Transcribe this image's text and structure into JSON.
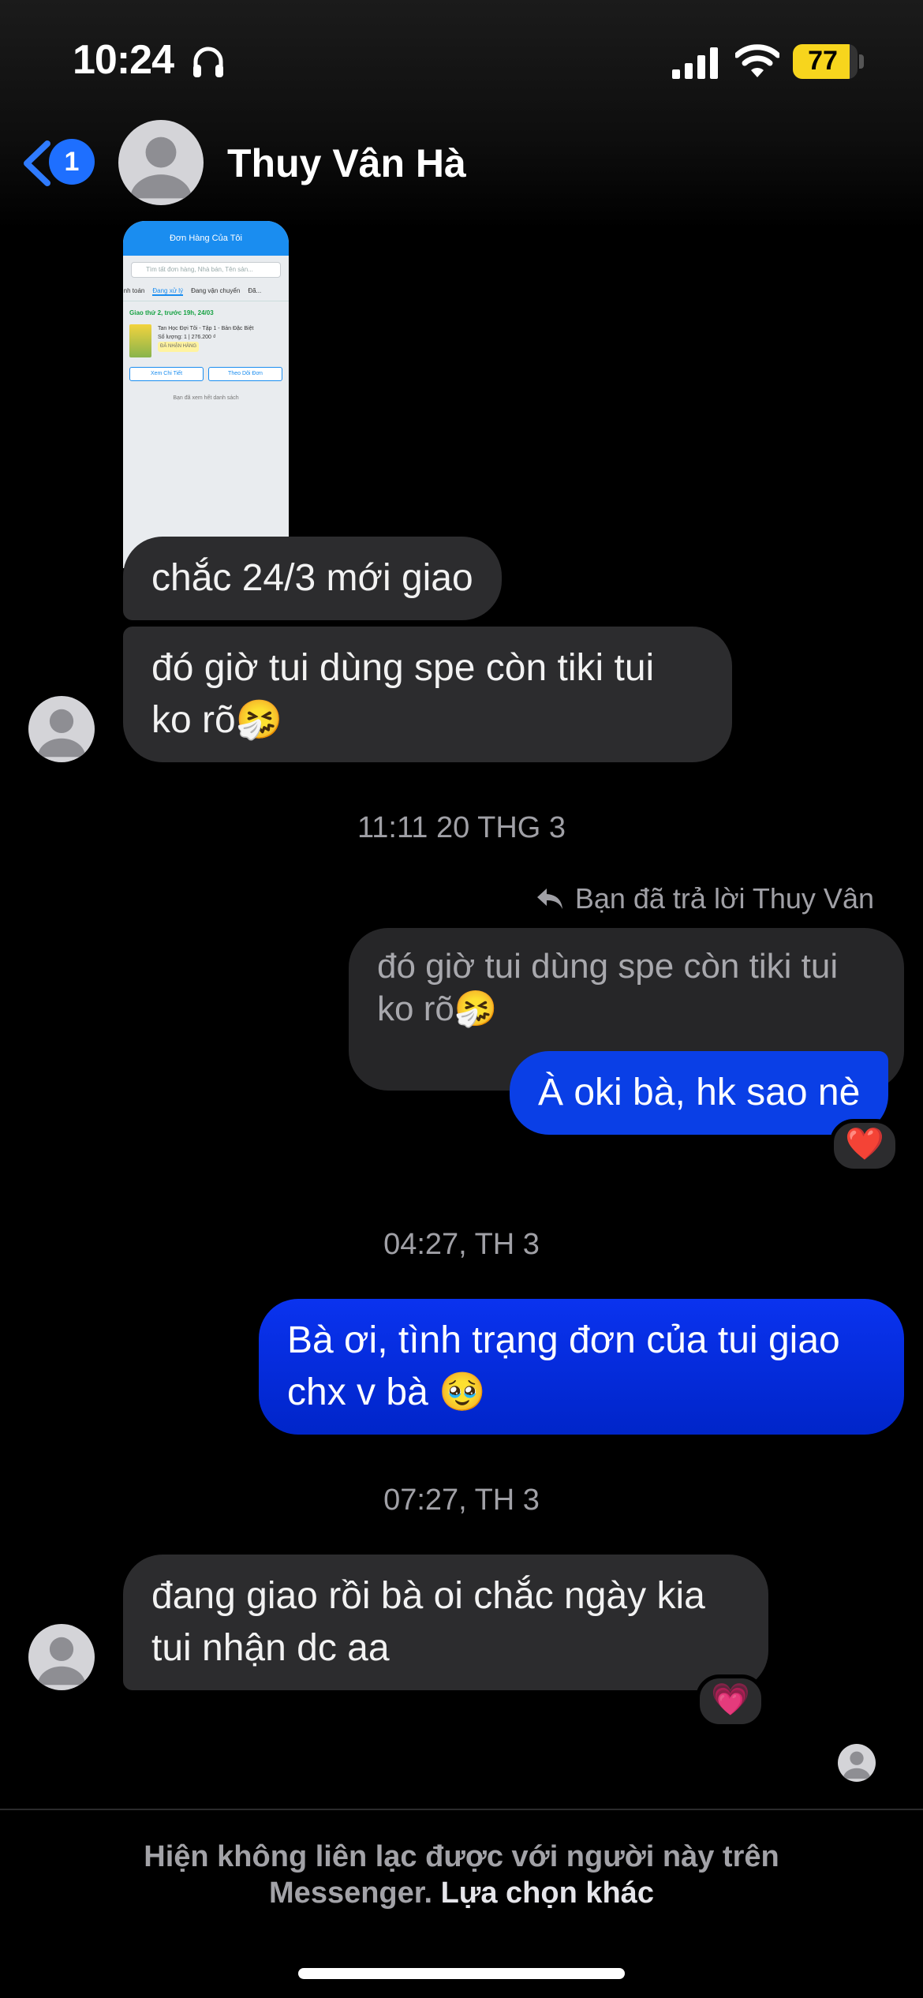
{
  "status_bar": {
    "time": "10:24",
    "battery": "77"
  },
  "header": {
    "back_badge": "1",
    "contact_name": "Thuy Vân Hà"
  },
  "shared_screenshot": {
    "title": "Đơn Hàng Của Tôi",
    "search_placeholder": "Tìm tất đơn hàng, Nhà bán, Tên sản...",
    "tabs": [
      "...nh toán",
      "Đang xử lý",
      "Đang vận chuyển",
      "Đã..."
    ],
    "delivery_date": "Giao thứ 2, trước 19h, 24/03",
    "item_title": "Tan Học Đợi Tôi - Tập 1 - Bản Đặc Biệt",
    "item_qty": "Số lượng: 1 | 276.200 ₫",
    "item_tag": "ĐÃ NHẬN HÀNG",
    "btn_detail": "Xem Chi Tiết",
    "btn_track": "Theo Dõi Đơn",
    "footer_text": "Bạn đã xem hết danh sách"
  },
  "messages": {
    "m1": "chắc 24/3 mới giao",
    "m2": "đó giờ tui dùng spe còn tiki tui ko rõ🤧",
    "ts1": "11:11 20 THG 3",
    "reply_label": "Bạn đã trả lời Thuy Vân",
    "quoted": "đó giờ tui dùng spe còn tiki tui ko rõ🤧",
    "m3": "À oki bà, hk sao nè",
    "m3_reaction": "❤️",
    "ts2": "04:27, TH 3",
    "m4": "Bà ơi, tình trạng đơn của tui giao chx v bà 🥹",
    "ts3": "07:27, TH 3",
    "m5": "đang giao rồi bà oi chắc ngày kia tui nhận dc aa",
    "m5_reaction": "💗"
  },
  "footer": {
    "notice": "Hiện không liên lạc được với người này trên Messenger.",
    "link": "Lựa chọn khác"
  }
}
